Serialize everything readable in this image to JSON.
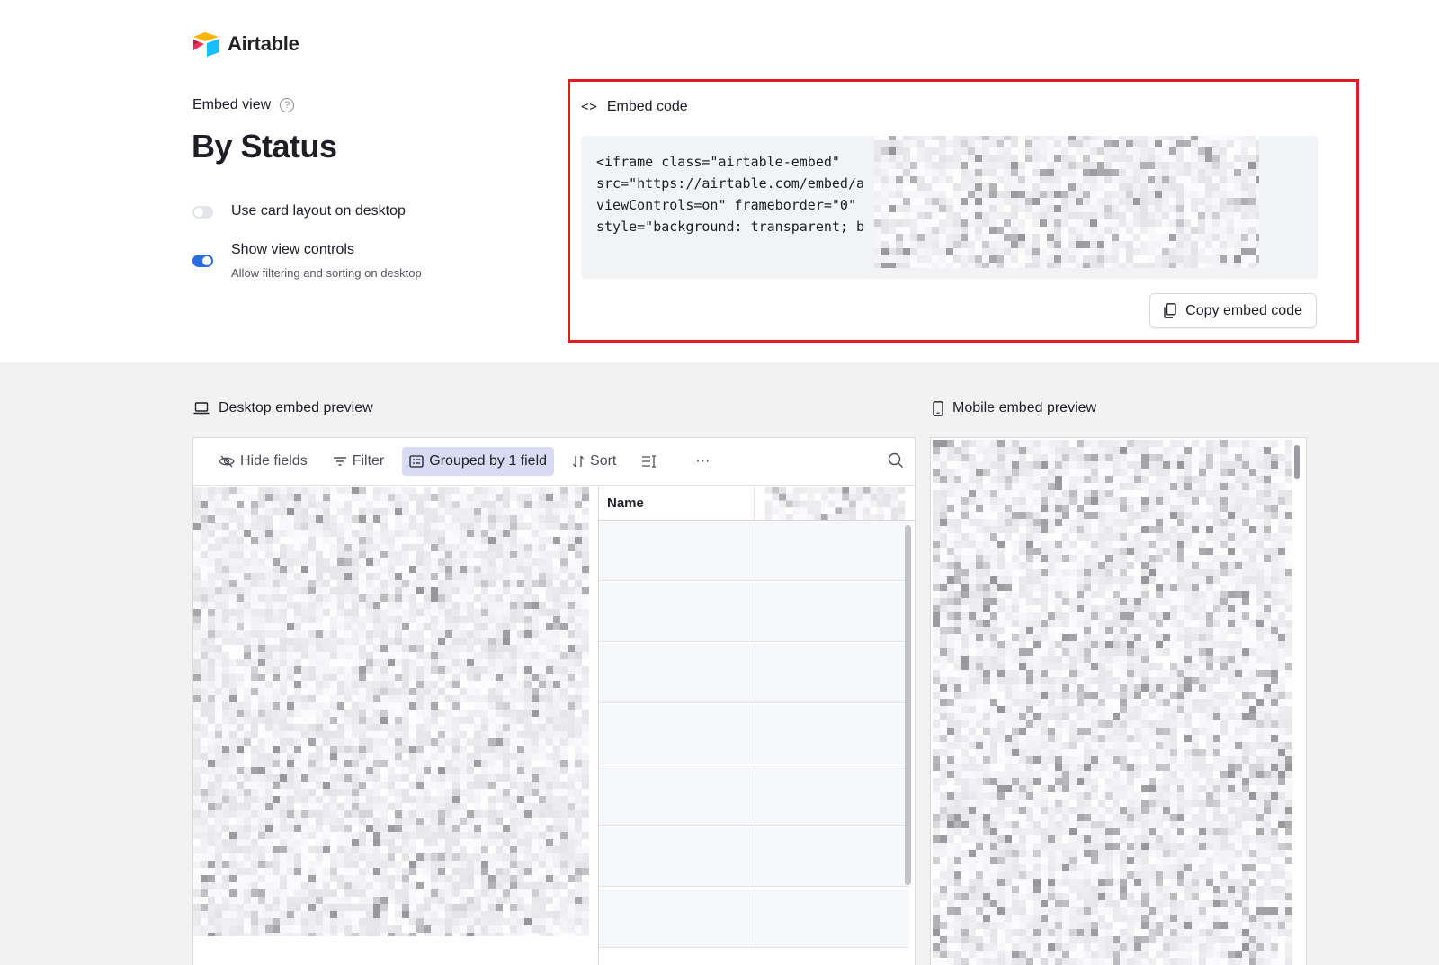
{
  "brand": {
    "name": "Airtable"
  },
  "config": {
    "embed_view_label": "Embed view",
    "help_icon": "?",
    "view_title": "By Status",
    "options": [
      {
        "label": "Use card layout on desktop",
        "enabled": false,
        "sub": ""
      },
      {
        "label": "Show view controls",
        "enabled": true,
        "sub": "Allow filtering and sorting on desktop"
      }
    ]
  },
  "embed_code": {
    "heading": "Embed code",
    "code_icon": "<>",
    "code_lines": "<iframe class=\"airtable-embed\"\nsrc=\"https://airtable.com/embed/a\nviewControls=on\" frameborder=\"0\"\nstyle=\"background: transparent; b",
    "copy_button": "Copy embed code"
  },
  "previews": {
    "desktop_label": "Desktop embed preview",
    "mobile_label": "Mobile embed preview",
    "toolbar": {
      "hide_fields": "Hide fields",
      "filter": "Filter",
      "group": "Grouped by 1 field",
      "sort": "Sort",
      "more": "···"
    },
    "grid": {
      "column_name": "Name"
    }
  },
  "colors": {
    "accent": "#2d6ce0",
    "highlight": "#e11b22",
    "group_active": "#d9dbf5"
  }
}
